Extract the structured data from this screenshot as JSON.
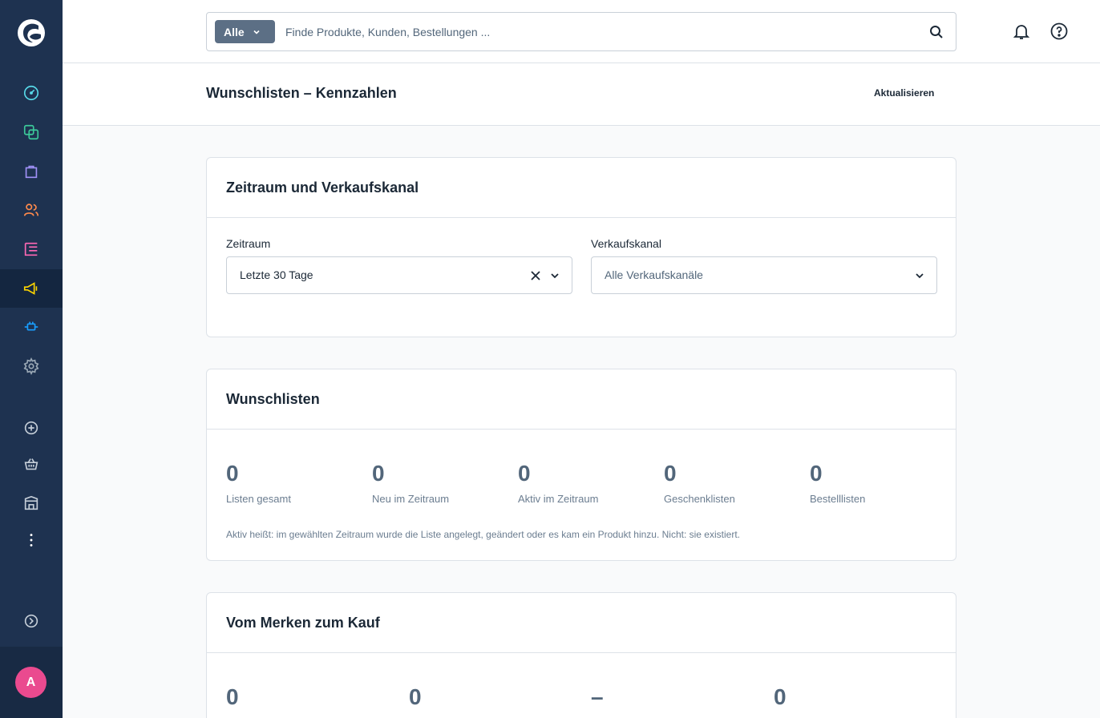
{
  "app": {
    "avatar_initial": "A",
    "accent_color": "#189eff",
    "avatar_color": "#ea4a8f"
  },
  "sidebar": {
    "items": [
      {
        "name": "dashboard",
        "icon": "gauge-icon"
      },
      {
        "name": "catalogues",
        "icon": "copy-icon"
      },
      {
        "name": "orders",
        "icon": "shopping-bag-icon"
      },
      {
        "name": "customers",
        "icon": "users-icon"
      },
      {
        "name": "content",
        "icon": "content-list-icon"
      },
      {
        "name": "marketing",
        "icon": "megaphone-icon",
        "active": true
      },
      {
        "name": "extensions",
        "icon": "plug-icon"
      },
      {
        "name": "settings",
        "icon": "gear-icon"
      },
      {
        "name": "add-sales-channel",
        "icon": "plus-circle-icon"
      },
      {
        "name": "storefront",
        "icon": "basket-icon"
      },
      {
        "name": "headless",
        "icon": "building-icon"
      },
      {
        "name": "more",
        "icon": "more-vertical-icon"
      },
      {
        "name": "expand",
        "icon": "chevron-circle-right-icon"
      }
    ]
  },
  "search": {
    "type_label": "Alle",
    "placeholder": "Finde Produkte, Kunden, Bestellungen ..."
  },
  "page": {
    "title": "Wunschlisten – Kennzahlen",
    "refresh_label": "Aktualisieren"
  },
  "filters": {
    "title": "Zeitraum und Verkaufskanal",
    "period_label": "Zeitraum",
    "period_value": "Letzte 30 Tage",
    "channel_label": "Verkaufskanal",
    "channel_value": "Alle Verkaufskanäle"
  },
  "wishlists": {
    "title": "Wunschlisten",
    "kpis": [
      {
        "value": "0",
        "label": "Listen gesamt"
      },
      {
        "value": "0",
        "label": "Neu im Zeitraum"
      },
      {
        "value": "0",
        "label": "Aktiv im Zeitraum"
      },
      {
        "value": "0",
        "label": "Geschenklisten"
      },
      {
        "value": "0",
        "label": "Bestelllisten"
      }
    ],
    "note": "Aktiv heißt: im gewählten Zeitraum wurde die Liste angelegt, geändert oder es kam ein Produkt hinzu. Nicht: sie existiert."
  },
  "conversion": {
    "title": "Vom Merken zum Kauf",
    "kpis": [
      {
        "value": "0"
      },
      {
        "value": "0"
      },
      {
        "value": "–"
      },
      {
        "value": "0"
      }
    ]
  }
}
